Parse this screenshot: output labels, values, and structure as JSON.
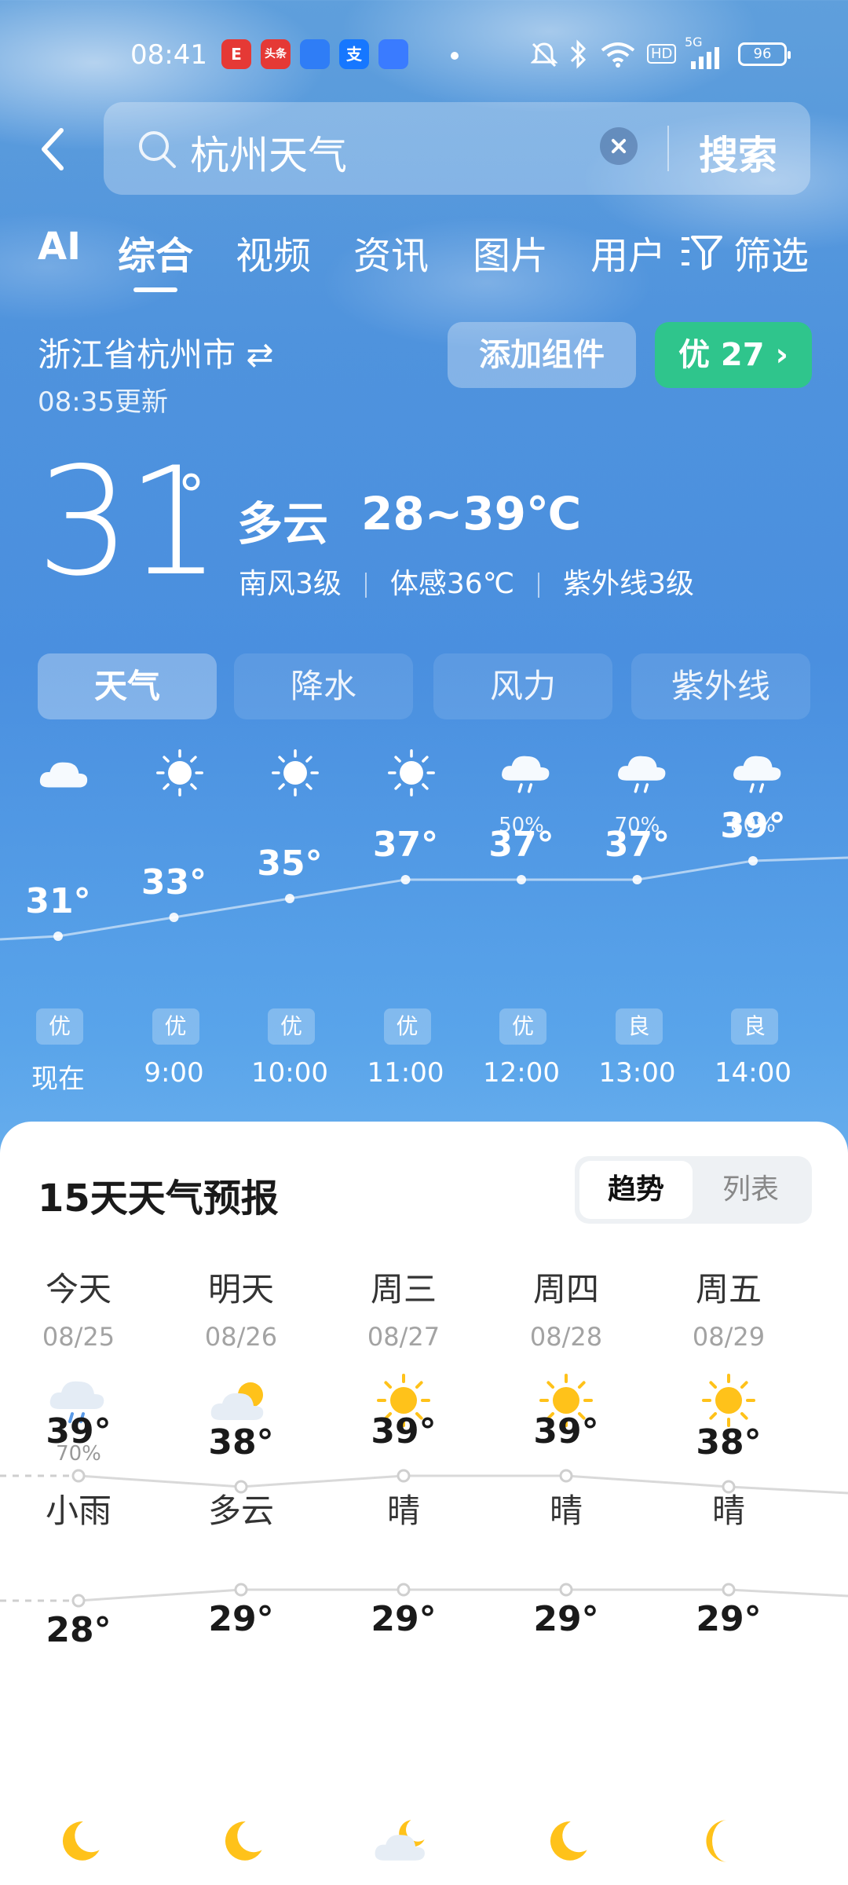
{
  "status_bar": {
    "time": "08:41",
    "apps": [
      {
        "name": "e-app",
        "label": "E",
        "color": "#e53935"
      },
      {
        "name": "toutiao-app",
        "label": "头条",
        "color": "#e53935"
      },
      {
        "name": "browser-app",
        "label": "",
        "color": "#2f7df6"
      },
      {
        "name": "alipay-app",
        "label": "支",
        "color": "#1677ff"
      },
      {
        "name": "app-5",
        "label": "",
        "color": "#3a7bff"
      }
    ],
    "signal_label": "5G",
    "hd_label": "HD",
    "battery": "96"
  },
  "search": {
    "query": "杭州天气",
    "button": "搜索"
  },
  "tabs": [
    {
      "label": "AI",
      "active": false
    },
    {
      "label": "综合",
      "active": true
    },
    {
      "label": "视频",
      "active": false
    },
    {
      "label": "资讯",
      "active": false
    },
    {
      "label": "图片",
      "active": false
    },
    {
      "label": "用户",
      "active": false
    }
  ],
  "filter_label": "筛选",
  "location": {
    "name": "浙江省杭州市 ⇄",
    "updated": "08:35更新",
    "add_widget": "添加组件",
    "aqi": "优 27 ›"
  },
  "current": {
    "temp": "31",
    "deg": "°",
    "condition": "多云",
    "range": "28~39℃",
    "wind": "南风3级",
    "feels_like": "体感36℃",
    "uv": "紫外线3级"
  },
  "segments": [
    "天气",
    "降水",
    "风力",
    "紫外线"
  ],
  "hourly": [
    {
      "time": "现在",
      "temp": "31°",
      "value": 31,
      "icon": "cloud",
      "prob": "",
      "aqi": "优"
    },
    {
      "time": "9:00",
      "temp": "33°",
      "value": 33,
      "icon": "sun",
      "prob": "",
      "aqi": "优"
    },
    {
      "time": "10:00",
      "temp": "35°",
      "value": 35,
      "icon": "sun",
      "prob": "",
      "aqi": "优"
    },
    {
      "time": "11:00",
      "temp": "37°",
      "value": 37,
      "icon": "sun",
      "prob": "",
      "aqi": "优"
    },
    {
      "time": "12:00",
      "temp": "37°",
      "value": 37,
      "icon": "rain",
      "prob": "50%",
      "aqi": "优"
    },
    {
      "time": "13:00",
      "temp": "37°",
      "value": 37,
      "icon": "rain",
      "prob": "70%",
      "aqi": "良"
    },
    {
      "time": "14:00",
      "temp": "39°",
      "value": 39,
      "icon": "rain",
      "prob": "80%",
      "aqi": "良"
    }
  ],
  "forecast": {
    "title": "15天天气预报",
    "toggle": [
      "趋势",
      "列表"
    ],
    "days": [
      {
        "name": "今天",
        "date": "08/25",
        "icon": "rain",
        "prob": "70%",
        "cond": "小雨",
        "high": "39°",
        "high_v": 39,
        "low": "28°",
        "low_v": 28,
        "night_icon": "moon"
      },
      {
        "name": "明天",
        "date": "08/26",
        "icon": "partly",
        "prob": "",
        "cond": "多云",
        "high": "38°",
        "high_v": 38,
        "low": "29°",
        "low_v": 29,
        "night_icon": "moon"
      },
      {
        "name": "周三",
        "date": "08/27",
        "icon": "sun",
        "prob": "",
        "cond": "晴",
        "high": "39°",
        "high_v": 39,
        "low": "29°",
        "low_v": 29,
        "night_icon": "moon-cloud"
      },
      {
        "name": "周四",
        "date": "08/28",
        "icon": "sun",
        "prob": "",
        "cond": "晴",
        "high": "39°",
        "high_v": 39,
        "low": "29°",
        "low_v": 29,
        "night_icon": "moon"
      },
      {
        "name": "周五",
        "date": "08/29",
        "icon": "sun",
        "prob": "",
        "cond": "晴",
        "high": "38°",
        "high_v": 38,
        "low": "29°",
        "low_v": 29,
        "night_icon": "moon-half"
      }
    ]
  },
  "colors": {
    "aqi_good": "#2fc58c",
    "sun": "#ffc21a"
  }
}
